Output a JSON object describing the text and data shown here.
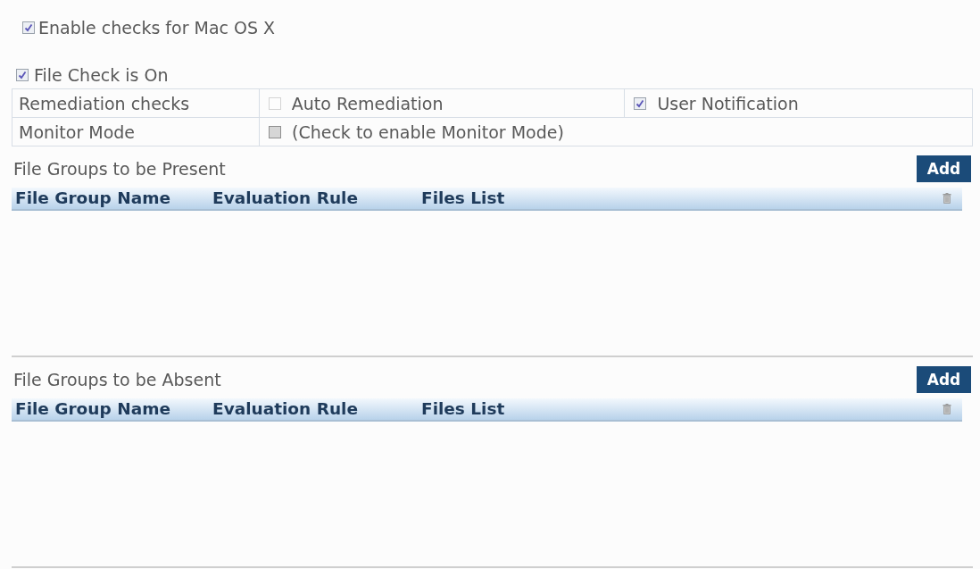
{
  "platform_toggle": {
    "label": "Enable checks for Mac OS X",
    "checked": true
  },
  "file_check": {
    "label": "File Check is On",
    "checked": true
  },
  "settings": [
    {
      "label": "Remediation checks",
      "options": [
        {
          "label": "Auto Remediation",
          "checked": false,
          "disabled": true
        },
        {
          "label": "User Notification",
          "checked": true,
          "disabled": false
        }
      ]
    },
    {
      "label": "Monitor Mode",
      "options": [
        {
          "label": "(Check to enable Monitor Mode)",
          "checked": false,
          "disabled": false
        }
      ]
    }
  ],
  "sections": [
    {
      "title": "File Groups to be Present",
      "add_button": "Add",
      "columns": [
        "File Group Name",
        "Evaluation Rule",
        "Files List"
      ]
    },
    {
      "title": "File Groups to be Absent",
      "add_button": "Add",
      "columns": [
        "File Group Name",
        "Evaluation Rule",
        "Files List"
      ]
    }
  ]
}
